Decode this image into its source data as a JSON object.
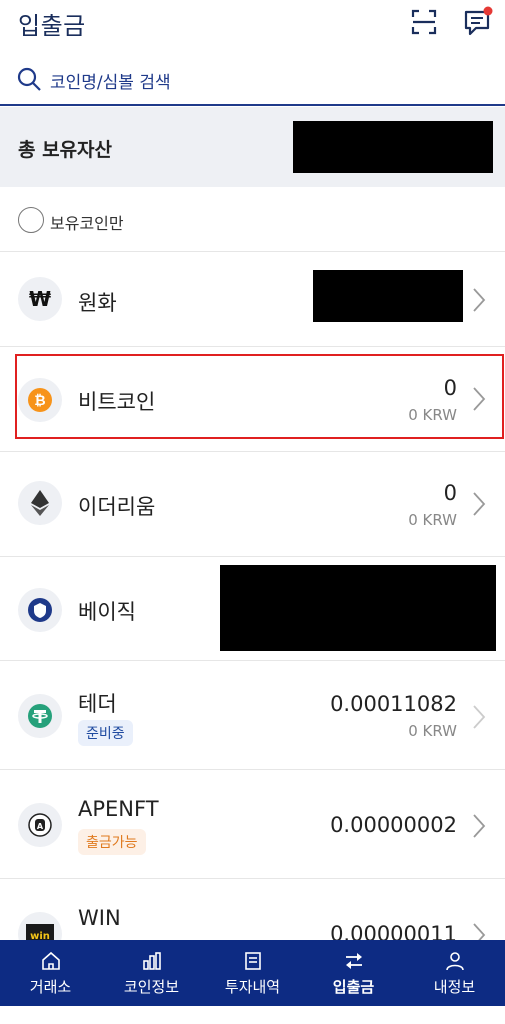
{
  "header": {
    "title": "입출금",
    "scan_icon": "scan-frame-icon",
    "chat_icon": "chat-notification-icon"
  },
  "search": {
    "placeholder": "코인명/심볼 검색",
    "icon": "search-icon"
  },
  "total": {
    "label": "총 보유자산"
  },
  "filter": {
    "label": "보유코인만"
  },
  "coins": [
    {
      "name": "원화",
      "icon": "won-icon"
    },
    {
      "name": "비트코인",
      "amount": "0",
      "krw": "0 KRW",
      "icon": "bitcoin-icon",
      "accent": "#f7931a"
    },
    {
      "name": "이더리움",
      "amount": "0",
      "krw": "0 KRW",
      "icon": "ethereum-icon"
    },
    {
      "name": "베이직",
      "icon": "basic-icon",
      "accent": "#1f3a8a"
    },
    {
      "name": "테더",
      "amount": "0.00011082",
      "krw": "0 KRW",
      "badge": "준비중",
      "icon": "tether-icon",
      "accent": "#26a17b"
    },
    {
      "name": "APENFT",
      "amount": "0.00000002",
      "badge": "출금가능",
      "icon": "apenft-icon"
    },
    {
      "name": "WIN",
      "amount": "0.00000011",
      "icon": "win-icon"
    }
  ],
  "bottom_nav": [
    {
      "label": "거래소",
      "icon": "home-icon"
    },
    {
      "label": "코인정보",
      "icon": "bar-chart-icon"
    },
    {
      "label": "투자내역",
      "icon": "document-icon"
    },
    {
      "label": "입출금",
      "icon": "transfer-icon",
      "active": true
    },
    {
      "label": "내정보",
      "icon": "user-icon"
    }
  ],
  "colors": {
    "brand": "#0d2b83",
    "highlight": "#e02020"
  }
}
